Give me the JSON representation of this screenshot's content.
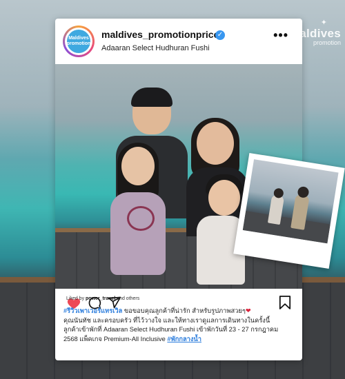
{
  "brand_watermark": {
    "name": "Maldives",
    "sub": "promotion"
  },
  "post": {
    "username": "maldives_promotionprice",
    "location": "Adaaran Select Hudhuran Fushi",
    "avatar_text": [
      "Maldives",
      "promotion"
    ],
    "more_icon": "more-horizontal-icon",
    "liked_by_prefix": "Liked by",
    "liked_by_user": "power_travel",
    "liked_by_suffix": "and others",
    "caption": {
      "hashtag_start": "#รีวิวเพาเวอร์แทรเวิล",
      "line1": " ขอขอบคุณลูกค้าที่น่ารัก สำหรับรูปภาพสวยๆ",
      "heart": "❤",
      "line2": "คุณนันทัช และครอบครัว ที่ไว้วางใจ และให้ทางเราดูแลการเดินทางในครั้งนี้",
      "line3": "ลูกค้าเข้าพักที่ Adaaran Select Hudhuran Fushi เข้าพักวันที่ 23 - 27 กรกฎาคม",
      "line4": "2568 แพ็คเกจ Premium-All Inclusive ",
      "hashtag_end": "#พักกลางน้ำ"
    }
  },
  "icons": {
    "like": "heart-filled-icon",
    "comment": "comment-icon",
    "share": "send-icon",
    "save": "bookmark-icon",
    "verified": "verified-badge-icon"
  },
  "colors": {
    "accent_red": "#ed4956",
    "hashtag_blue": "#2f7fdd",
    "verified_blue": "#3897f0"
  }
}
